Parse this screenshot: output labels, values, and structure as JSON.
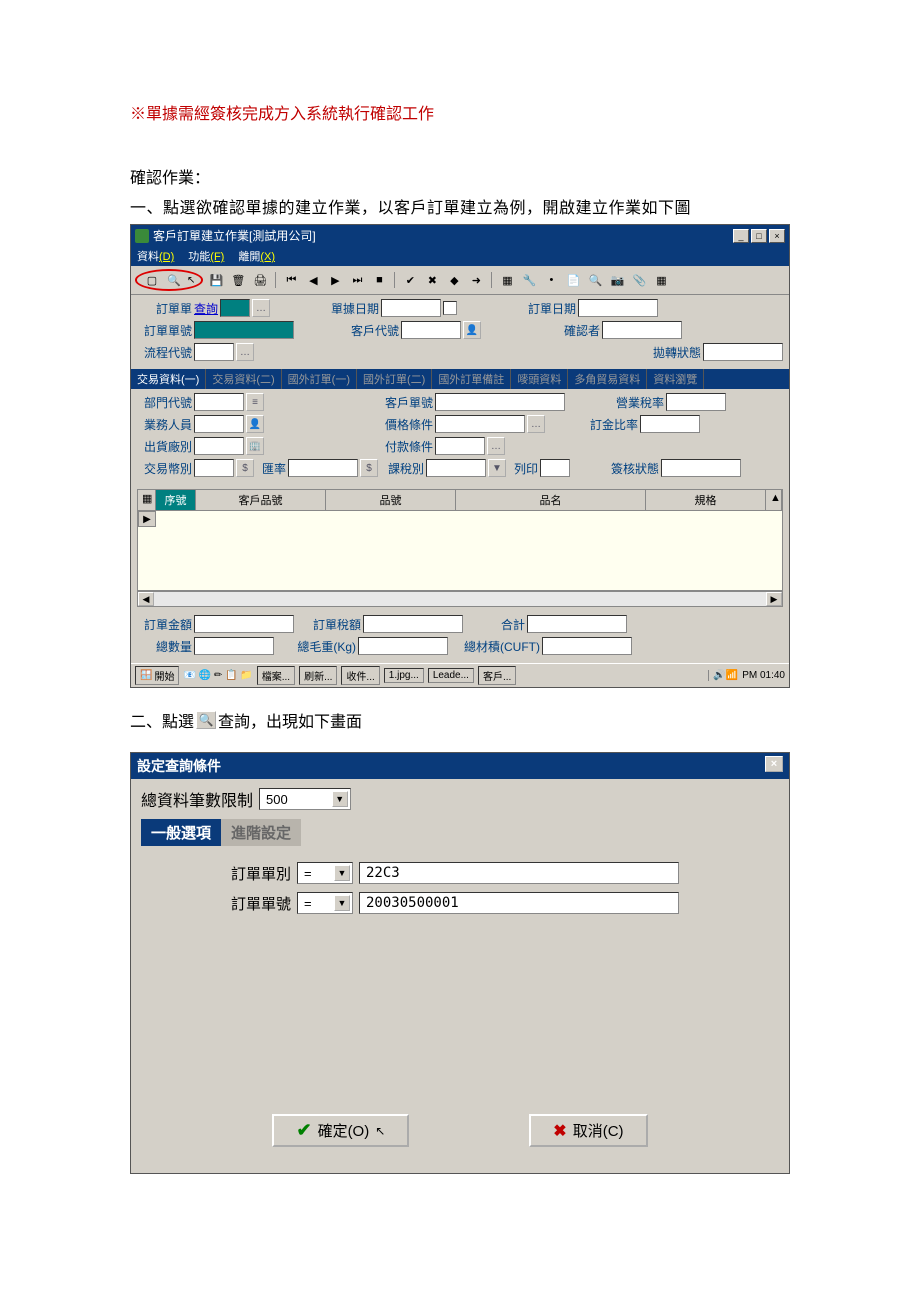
{
  "doc": {
    "note": "※單據需經簽核完成方入系統執行確認工作",
    "confirm_label": "確認作業：",
    "step1": "一、點選欲確認單據的建立作業，以客戶訂單建立為例，開啟建立作業如下圖",
    "step2_prefix": "二、點選",
    "step2_suffix": "查詢，出現如下畫面"
  },
  "win1": {
    "title": "客戶訂單建立作業[測試用公司]",
    "menu": {
      "data": "資料",
      "data_k": "(D)",
      "func": "功能",
      "func_k": "(F)",
      "exit": "離開",
      "exit_k": "(X)"
    },
    "labels": {
      "order_type": "訂單單",
      "lookup": "查詢",
      "order_no": "訂單單號",
      "flow_no": "流程代號",
      "doc_date": "單據日期",
      "cust_no": "客戶代號",
      "order_date": "訂單日期",
      "confirmer": "確認者",
      "fwd_status": "拋轉狀態"
    },
    "tabs": [
      "交易資料(一)",
      "交易資料(二)",
      "國外訂單(一)",
      "國外訂單(二)",
      "國外訂單備註",
      "嘜頭資料",
      "多角貿易資料",
      "資料瀏覽"
    ],
    "f2": {
      "dept": "部門代號",
      "cust_po": "客戶單號",
      "tax_rate": "營業稅率",
      "sales": "業務人員",
      "price_term": "價格條件",
      "deposit": "訂金比率",
      "ship_from": "出貨廠別",
      "pay_term": "付款條件",
      "currency": "交易幣別",
      "rate": "匯率",
      "tax_type": "課稅別",
      "print": "列印",
      "sign_status": "簽核狀態"
    },
    "grid": {
      "seq": "序號",
      "cust_item": "客戶品號",
      "item_no": "品號",
      "item_name": "品名",
      "spec": "規格"
    },
    "totals": {
      "order_amt": "訂單金額",
      "order_tax": "訂單稅額",
      "total": "合計",
      "qty": "總數量",
      "gross_kg": "總毛重(Kg)",
      "cuft": "總材積(CUFT)"
    },
    "taskbar": {
      "start": "開始",
      "items": [
        "檔案...",
        "刷新...",
        "收件...",
        "1.jpg...",
        "Leade...",
        "客戶..."
      ],
      "clock": "PM 01:40"
    }
  },
  "dlg": {
    "title": "設定查詢條件",
    "limit_label": "總資料筆數限制",
    "limit_value": "500",
    "tabs": {
      "general": "一般選項",
      "advanced": "進階設定"
    },
    "rows": {
      "order_type_label": "訂單單別",
      "order_type_op": "=",
      "order_type_val": "22C3",
      "order_no_label": "訂單單號",
      "order_no_op": "=",
      "order_no_val": "20030500001"
    },
    "buttons": {
      "ok": "確定(O)",
      "cancel": "取消(C)"
    }
  }
}
